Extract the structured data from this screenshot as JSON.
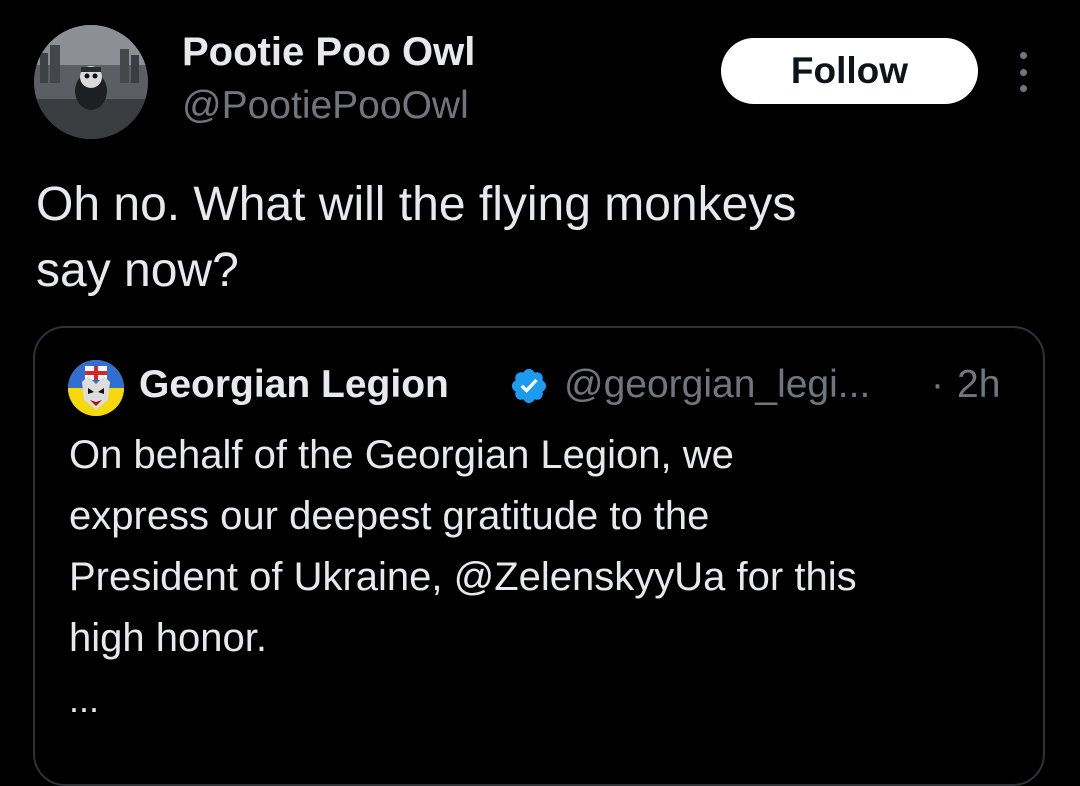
{
  "tweet": {
    "author_name": "Pootie Poo Owl",
    "author_handle": "@PootiePooOwl",
    "follow_label": "Follow",
    "more_icon": "more-vertical-icon",
    "text_line1": "Oh no. What will the flying monkeys",
    "text_line2": "say now?"
  },
  "quoted_tweet": {
    "author_name": "Georgian Legion",
    "verified_icon": "verified-badge-icon",
    "author_handle": "@georgian_legi...",
    "separator": "·",
    "time": "2h",
    "text_line1": "On behalf of the Georgian Legion, we",
    "text_line2": "express our deepest gratitude to the",
    "text_line3": "President of Ukraine, @ZelenskyyUa for this",
    "text_line4": "high honor.",
    "ellipsis": "..."
  },
  "colors": {
    "background": "#000000",
    "primary_text": "#e7e9ea",
    "secondary_text": "#71767b",
    "border": "#2f3336",
    "follow_button_bg": "#ffffff",
    "follow_button_text": "#0f1419",
    "verified_blue": "#1d9bf0"
  }
}
